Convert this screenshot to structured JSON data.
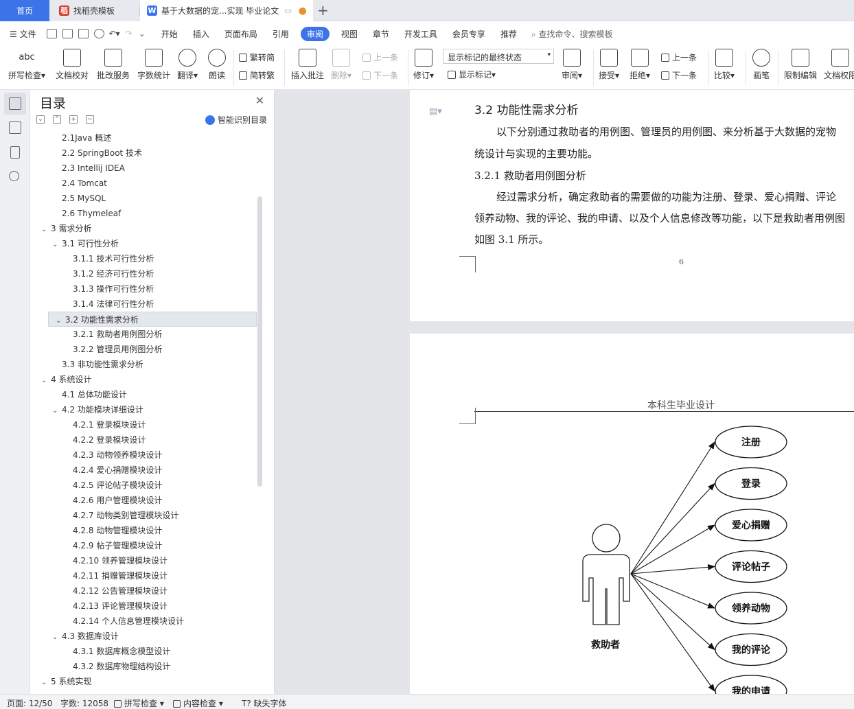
{
  "tabs": {
    "home": "首页",
    "template": "找稻壳模板",
    "doc": "基于大数据的宠...实现 毕业论文"
  },
  "menu": {
    "file": "文件",
    "items": [
      "开始",
      "插入",
      "页面布局",
      "引用",
      "审阅",
      "视图",
      "章节",
      "开发工具",
      "会员专享",
      "推荐"
    ],
    "search": "查找命令、搜索模板"
  },
  "ribbon": {
    "spell": "拼写检查",
    "proof": "文档校对",
    "revise": "批改服务",
    "wordcount": "字数统计",
    "translate": "翻译",
    "read": "朗读",
    "t2s": "繁转简",
    "s2t": "简转繁",
    "comment": "插入批注",
    "delete": "删除",
    "prev": "上一条",
    "next": "下一条",
    "track": "修订",
    "display_state": "显示标记的最终状态",
    "show_marks": "显示标记",
    "review": "审阅",
    "accept": "接受",
    "reject": "拒绝",
    "prev2": "上一条",
    "next2": "下一条",
    "compare": "比较",
    "pen": "画笔",
    "restrict": "限制编辑",
    "perm": "文档权限"
  },
  "toc": {
    "title": "目录",
    "smart": "智能识别目录",
    "items": [
      {
        "label": "2.1Java 概述",
        "lvl": 2,
        "tg": ""
      },
      {
        "label": "2.2 SpringBoot 技术",
        "lvl": 2,
        "tg": ""
      },
      {
        "label": "2.3 Intellij IDEA",
        "lvl": 2,
        "tg": ""
      },
      {
        "label": "2.4 Tomcat",
        "lvl": 2,
        "tg": ""
      },
      {
        "label": "2.5 MySQL",
        "lvl": 2,
        "tg": ""
      },
      {
        "label": "2.6 Thymeleaf",
        "lvl": 2,
        "tg": ""
      },
      {
        "label": "3  需求分析",
        "lvl": 1,
        "tg": "v"
      },
      {
        "label": "3.1 可行性分析",
        "lvl": 2,
        "tg": "v"
      },
      {
        "label": "3.1.1  技术可行性分析",
        "lvl": 3,
        "tg": ""
      },
      {
        "label": "3.1.2  经济可行性分析",
        "lvl": 3,
        "tg": ""
      },
      {
        "label": "3.1.3  操作可行性分析",
        "lvl": 3,
        "tg": ""
      },
      {
        "label": "3.1.4  法律可行性分析",
        "lvl": 3,
        "tg": ""
      },
      {
        "label": "3.2  功能性需求分析",
        "lvl": 2,
        "tg": "v",
        "sel": true
      },
      {
        "label": "3.2.1 救助者用例图分析",
        "lvl": 3,
        "tg": ""
      },
      {
        "label": "3.2.2  管理员用例图分析",
        "lvl": 3,
        "tg": ""
      },
      {
        "label": "3.3  非功能性需求分析",
        "lvl": 2,
        "tg": ""
      },
      {
        "label": "4  系统设计",
        "lvl": 1,
        "tg": "v"
      },
      {
        "label": "4.1  总体功能设计",
        "lvl": 2,
        "tg": ""
      },
      {
        "label": "4.2  功能模块详细设计",
        "lvl": 2,
        "tg": "v"
      },
      {
        "label": "4.2.1  登录模块设计",
        "lvl": 3,
        "tg": ""
      },
      {
        "label": "4.2.2  登录模块设计",
        "lvl": 3,
        "tg": ""
      },
      {
        "label": "4.2.3  动物领养模块设计",
        "lvl": 3,
        "tg": ""
      },
      {
        "label": "4.2.4 爱心捐赠模块设计",
        "lvl": 3,
        "tg": ""
      },
      {
        "label": "4.2.5 评论帖子模块设计",
        "lvl": 3,
        "tg": ""
      },
      {
        "label": "4.2.6 用户管理模块设计",
        "lvl": 3,
        "tg": ""
      },
      {
        "label": "4.2.7 动物类别管理模块设计",
        "lvl": 3,
        "tg": ""
      },
      {
        "label": "4.2.8 动物管理模块设计",
        "lvl": 3,
        "tg": ""
      },
      {
        "label": "4.2.9 帖子管理模块设计",
        "lvl": 3,
        "tg": ""
      },
      {
        "label": "4.2.10 领养管理模块设计",
        "lvl": 3,
        "tg": ""
      },
      {
        "label": "4.2.11 捐赠管理模块设计",
        "lvl": 3,
        "tg": ""
      },
      {
        "label": "4.2.12 公告管理模块设计",
        "lvl": 3,
        "tg": ""
      },
      {
        "label": "4.2.13 评论管理模块设计",
        "lvl": 3,
        "tg": ""
      },
      {
        "label": "4.2.14 个人信息管理模块设计",
        "lvl": 3,
        "tg": ""
      },
      {
        "label": "4.3  数据库设计",
        "lvl": 2,
        "tg": "v"
      },
      {
        "label": "4.3.1 数据库概念模型设计",
        "lvl": 3,
        "tg": ""
      },
      {
        "label": "4.3.2 数据库物理结构设计",
        "lvl": 3,
        "tg": ""
      },
      {
        "label": "5  系统实现",
        "lvl": 1,
        "tg": "v"
      }
    ]
  },
  "doc": {
    "heading": "3.2  功能性需求分析",
    "p1a": "以下分别通过救助者的用例图、管理员的用例图、来分析基于大数据的宠物",
    "p1b": "统设计与实现的主要功能。",
    "sub": "3.2.1 救助者用例图分析",
    "p2a": "经过需求分析，确定救助者的需要做的功能为注册、登录、爱心捐赠、评论",
    "p2b": "领养动物、我的评论、我的申请、以及个人信息修改等功能，以下是救助者用例图",
    "p2c": "如图 3.1 所示。",
    "pagenum": "6",
    "header2": "本科生毕业设计",
    "actor": "救助者",
    "usecases": [
      "注册",
      "登录",
      "爱心捐赠",
      "评论帖子",
      "领养动物",
      "我的评论",
      "我的申请"
    ]
  },
  "status": {
    "page": "页面: 12/50",
    "words": "字数: 12058",
    "spell": "拼写检查",
    "content": "内容检查",
    "font": "缺失字体"
  },
  "colors": {
    "accent": "#3b74e8",
    "wps": "#d9362b"
  }
}
